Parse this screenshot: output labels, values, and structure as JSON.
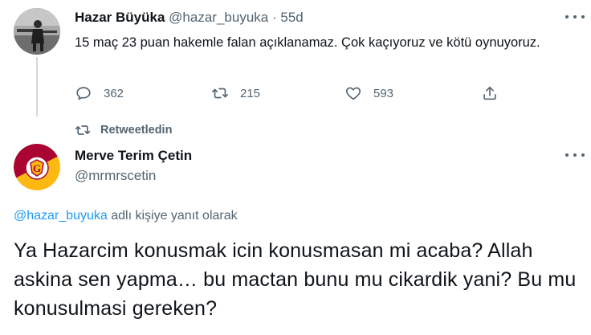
{
  "original_tweet": {
    "display_name": "Hazar Büyüka",
    "handle": "@hazar_buyuka",
    "separator": "·",
    "time": "55d",
    "text": "15 maç 23 puan hakemle falan açıklanamaz. Çok kaçıyoruz ve kötü oynuyoruz.",
    "actions": {
      "reply_icon": "speech-bubble-icon",
      "replies": "362",
      "retweet_icon": "retweet-icon",
      "retweets": "215",
      "like_icon": "heart-icon",
      "likes": "593",
      "share_icon": "share-icon"
    }
  },
  "retweet_notice": {
    "icon": "retweet-icon",
    "label": "Retweetledin"
  },
  "reply_tweet": {
    "display_name": "Merve Terim Çetin",
    "handle": "@mrmrscetin",
    "avatar_icon": "galatasaray-logo-icon",
    "replying_to_mention": "@hazar_buyuka",
    "replying_to_suffix": " adlı kişiye yanıt olarak",
    "text": "Ya Hazarcim konusmak icin konusmasan mi acaba? Allah askina sen yapma… bu mactan bunu mu cikardik yani? Bu mu konusulmasi gereken?"
  },
  "colors": {
    "text_primary": "#0f1419",
    "text_secondary": "#536471",
    "link": "#1d9bf0",
    "thread_line": "#cfd9de",
    "galatasaray_red": "#a90432",
    "galatasaray_yellow": "#fdb912"
  }
}
